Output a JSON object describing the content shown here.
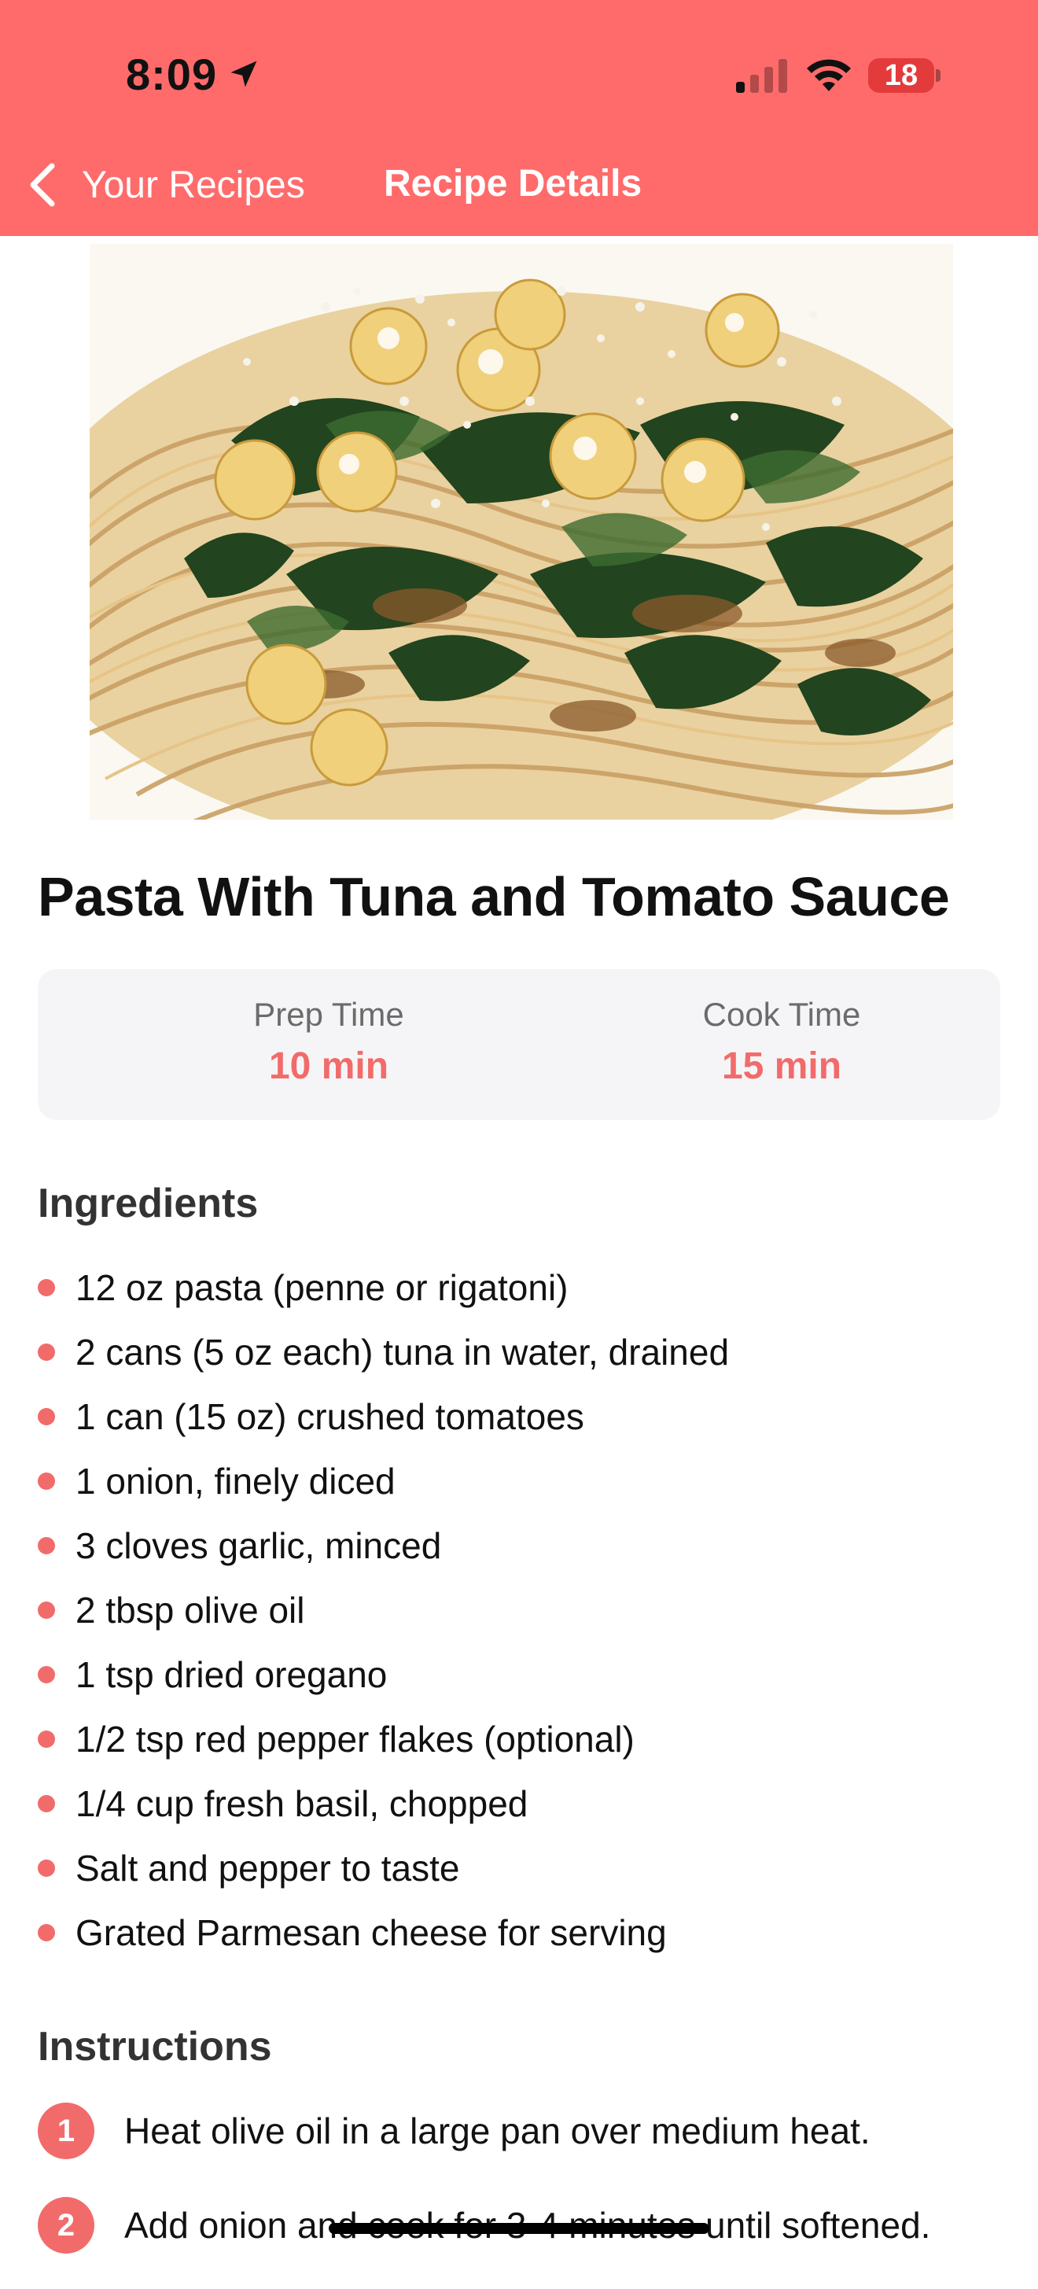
{
  "status_bar": {
    "time": "8:09",
    "battery": "18"
  },
  "nav": {
    "back_label": "Your Recipes",
    "title": "Recipe Details"
  },
  "recipe": {
    "title": "Pasta With Tuna and Tomato Sauce",
    "prep_label": "Prep Time",
    "prep_value": "10 min",
    "cook_label": "Cook Time",
    "cook_value": "15 min"
  },
  "ingredients": {
    "heading": "Ingredients",
    "items": [
      "12 oz pasta (penne or rigatoni)",
      "2 cans (5 oz each) tuna in water, drained",
      "1 can (15 oz) crushed tomatoes",
      "1 onion, finely diced",
      "3 cloves garlic, minced",
      "2 tbsp olive oil",
      "1 tsp dried oregano",
      "1/2 tsp red pepper flakes (optional)",
      "1/4 cup fresh basil, chopped",
      "Salt and pepper to taste",
      "Grated Parmesan cheese for serving"
    ]
  },
  "instructions": {
    "heading": "Instructions",
    "steps": [
      {
        "num": "1",
        "text": "Heat olive oil in a large pan over medium heat."
      },
      {
        "num": "2",
        "text": "Add onion and cook for 3-4 minutes until softened."
      }
    ]
  },
  "colors": {
    "header": "#FF6B6B",
    "accent": "#F26B6B"
  }
}
